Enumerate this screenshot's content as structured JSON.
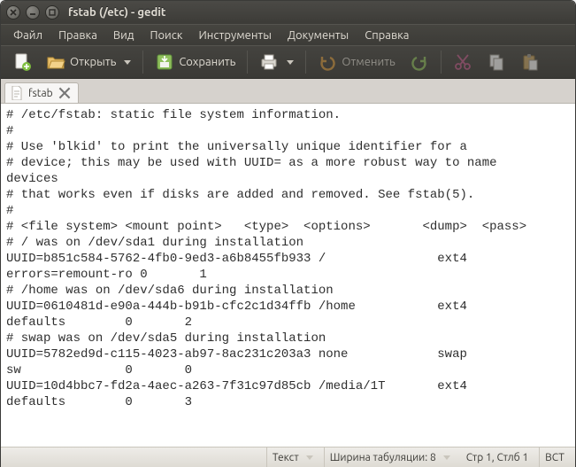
{
  "window": {
    "title": "fstab (/etc) - gedit"
  },
  "menubar": {
    "items": [
      "Файл",
      "Правка",
      "Вид",
      "Поиск",
      "Инструменты",
      "Документы",
      "Справка"
    ]
  },
  "toolbar": {
    "open_label": "Открыть",
    "save_label": "Сохранить",
    "undo_label": "Отменить"
  },
  "tab": {
    "label": "fstab"
  },
  "file_content": "# /etc/fstab: static file system information.\n#\n# Use 'blkid' to print the universally unique identifier for a\n# device; this may be used with UUID= as a more robust way to name\ndevices\n# that works even if disks are added and removed. See fstab(5).\n#\n# <file system> <mount point>   <type>  <options>       <dump>  <pass>\n# / was on /dev/sda1 during installation\nUUID=b851c584-5762-4fb0-9ed3-a6b8455fb933 /               ext4    \nerrors=remount-ro 0       1\n# /home was on /dev/sda6 during installation\nUUID=0610481d-e90a-444b-b91b-cfc2c1d34ffb /home           ext4    \ndefaults        0       2\n# swap was on /dev/sda5 during installation\nUUID=5782ed9d-c115-4023-ab97-8ac231c203a3 none            swap    \nsw              0       0\nUUID=10d4bbc7-fd2a-4aec-a263-7f31c97d85cb /media/1T       ext4    \ndefaults        0       3",
  "statusbar": {
    "syntax_label": "Текст",
    "tabwidth_label": "Ширина табуляции: 8",
    "position_label": "Стр 1, Стлб 1",
    "insert_mode": "ВСТ"
  }
}
